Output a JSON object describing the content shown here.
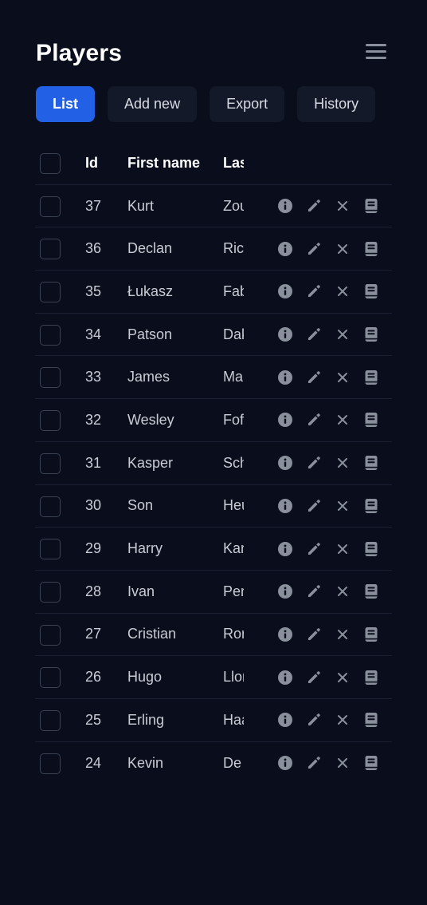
{
  "header": {
    "title": "Players",
    "menu_icon": "hamburger-menu-icon"
  },
  "tabs": [
    {
      "label": "List",
      "active": true
    },
    {
      "label": "Add new",
      "active": false
    },
    {
      "label": "Export",
      "active": false
    },
    {
      "label": "History",
      "active": false
    }
  ],
  "table": {
    "columns": [
      "Id",
      "First name",
      "Last name"
    ],
    "row_actions": [
      "info-icon",
      "edit-pencil-icon",
      "delete-x-icon",
      "book-icon"
    ],
    "rows": [
      {
        "id": "37",
        "first": "Kurt",
        "last": "Zou"
      },
      {
        "id": "36",
        "first": "Declan",
        "last": "Ric"
      },
      {
        "id": "35",
        "first": "Łukasz",
        "last": "Fab"
      },
      {
        "id": "34",
        "first": "Patson",
        "last": "Dak"
      },
      {
        "id": "33",
        "first": "James",
        "last": "Ma"
      },
      {
        "id": "32",
        "first": "Wesley",
        "last": "Fof"
      },
      {
        "id": "31",
        "first": "Kasper",
        "last": "Sch"
      },
      {
        "id": "30",
        "first": "Son",
        "last": "Heu"
      },
      {
        "id": "29",
        "first": "Harry",
        "last": "Kar"
      },
      {
        "id": "28",
        "first": "Ivan",
        "last": "Per"
      },
      {
        "id": "27",
        "first": "Cristian",
        "last": "Ror"
      },
      {
        "id": "26",
        "first": "Hugo",
        "last": "Llor"
      },
      {
        "id": "25",
        "first": "Erling",
        "last": "Haa"
      },
      {
        "id": "24",
        "first": "Kevin",
        "last": "De"
      }
    ]
  },
  "colors": {
    "background": "#0a0e1c",
    "accent": "#2260e6",
    "tab_bg": "#141929",
    "icon": "#8a8f9c"
  }
}
